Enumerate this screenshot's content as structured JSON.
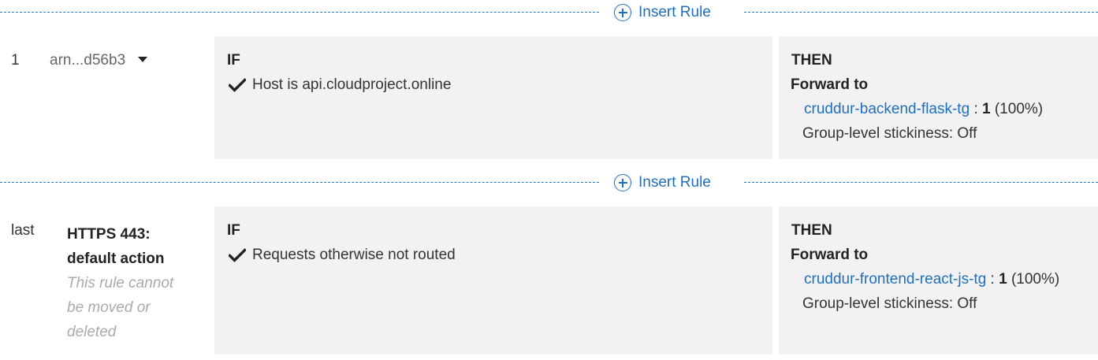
{
  "insert_label": "Insert Rule",
  "rules": [
    {
      "number": "1",
      "name": "arn...d56b3",
      "if_heading": "IF",
      "condition": "Host is api.cloudproject.online",
      "then_heading": "THEN",
      "action": "Forward to",
      "target_group": "cruddur-backend-flask-tg",
      "sep": ":",
      "weight": "1",
      "percent": "(100%)",
      "stickiness": "Group-level stickiness: Off"
    },
    {
      "number": "last",
      "title_line1": "HTTPS 443:",
      "title_line2": "default action",
      "note_line1": "This rule cannot",
      "note_line2": "be moved or",
      "note_line3": "deleted",
      "if_heading": "IF",
      "condition": "Requests otherwise not routed",
      "then_heading": "THEN",
      "action": "Forward to",
      "target_group": "cruddur-frontend-react-js-tg",
      "sep": ":",
      "weight": "1",
      "percent": "(100%)",
      "stickiness": "Group-level stickiness: Off"
    }
  ],
  "icons": {
    "insert": "plus-circle-icon",
    "condition": "checkmark-icon",
    "dropdown": "caret-down-icon"
  },
  "colors": {
    "link": "#1f6fbf",
    "panel_bg": "#f2f2f2",
    "dashed_line": "#1f7bc1",
    "note_text": "#aaaaaa"
  }
}
